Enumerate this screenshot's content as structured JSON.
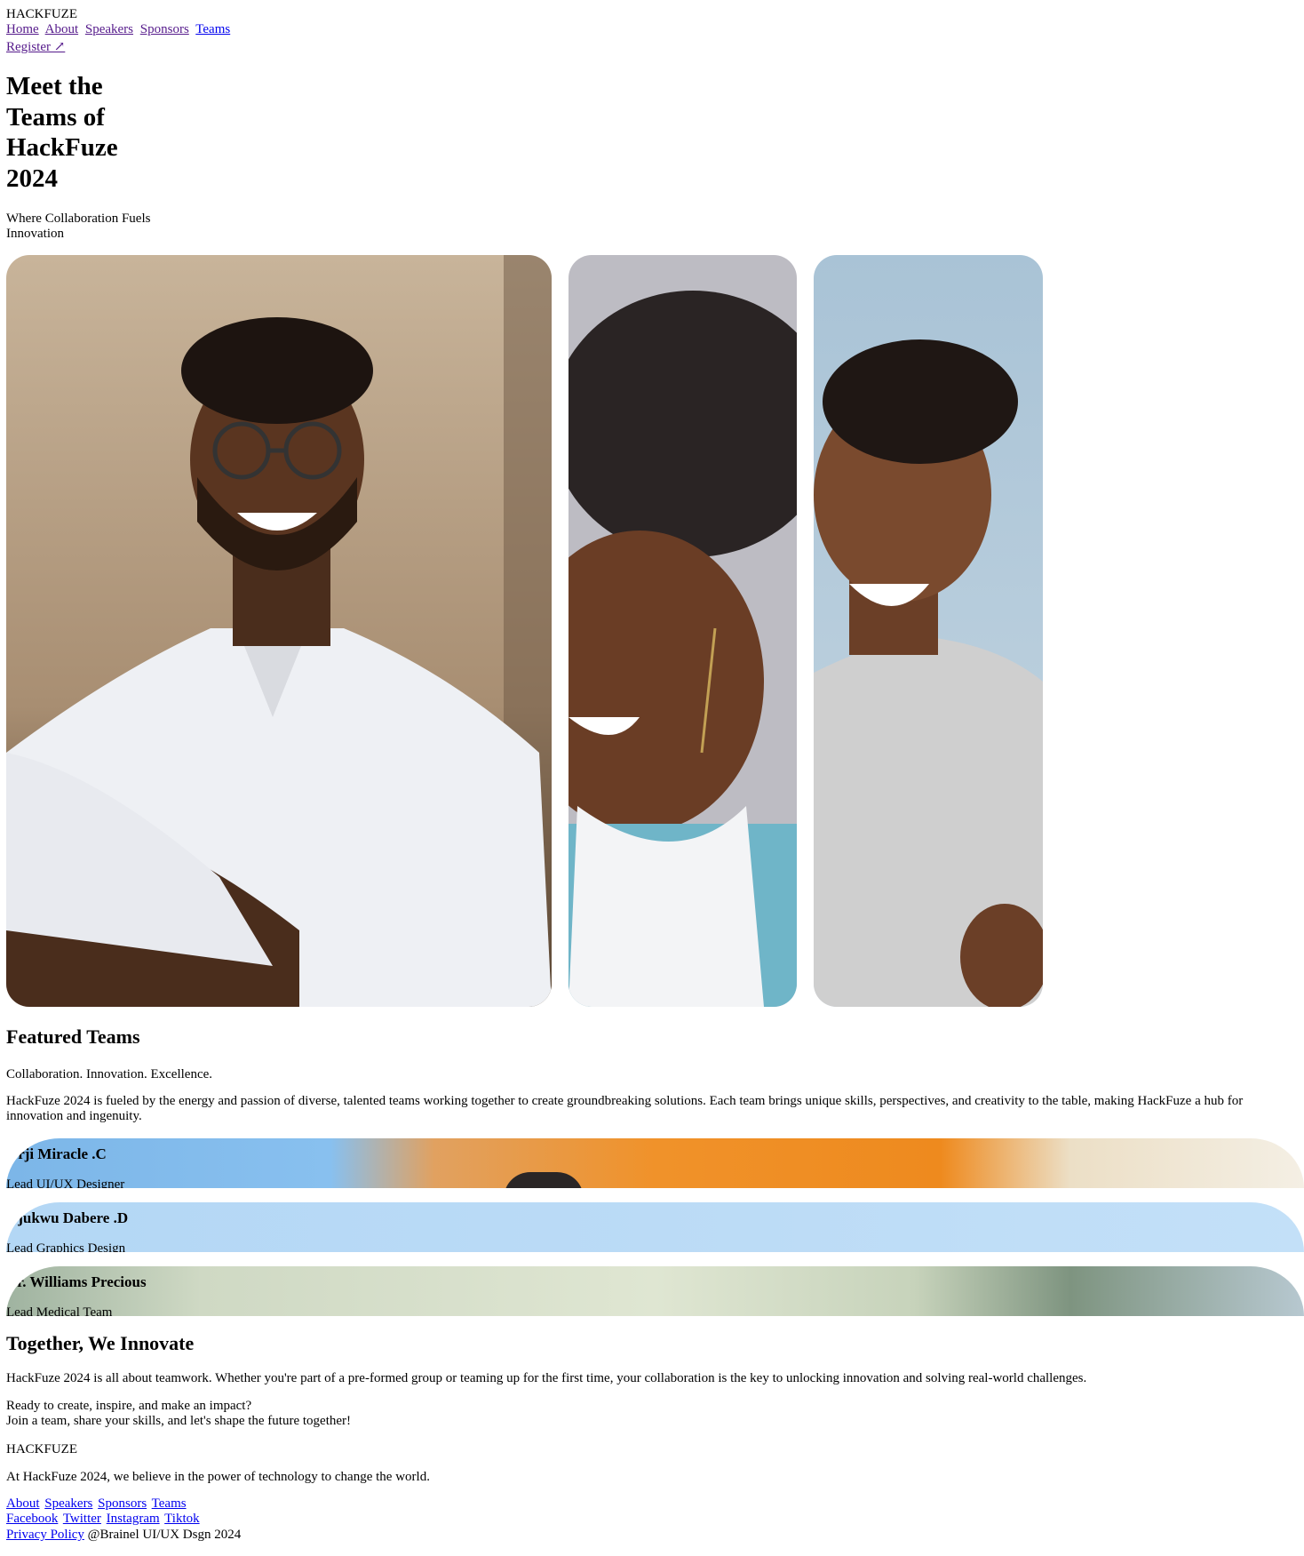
{
  "header": {
    "brand": "HACKFUZE",
    "nav": [
      "Home",
      "About",
      "Speakers",
      "Sponsors",
      "Teams"
    ],
    "register": "Register ↗"
  },
  "hero": {
    "title": "Meet the Teams of HackFuze 2024",
    "subtitle": "Where Collaboration Fuels Innovation"
  },
  "featured": {
    "title": "Featured Teams",
    "tagline": "Collaboration. Innovation. Excellence.",
    "description": "HackFuze 2024 is fueled by the energy and passion of diverse, talented teams working together to create groundbreaking solutions. Each team brings unique skills, perspectives, and creativity to the table, making HackFuze a hub for innovation and ingenuity.",
    "members": [
      {
        "name": "Orji Miracle .C",
        "role": "Lead UI/UX Designer"
      },
      {
        "name": "Ojukwu Dabere .D",
        "role": "Lead Graphics Design"
      },
      {
        "name": "Dr. Williams Precious",
        "role": "Lead Medical Team"
      }
    ]
  },
  "together": {
    "title": "Together, We Innovate",
    "description": "HackFuze 2024 is all about teamwork. Whether you're part of a pre-formed group or teaming up for the first time, your collaboration is the key to unlocking innovation and solving real-world challenges.",
    "cta_line1": "Ready to create, inspire, and make an impact?",
    "cta_line2": "Join a team, share your skills, and let's shape the future together!"
  },
  "footer": {
    "brand": "HACKFUZE",
    "about": "At HackFuze 2024, we believe in the power of technology to change the world.",
    "links": [
      "About",
      "Speakers",
      "Sponsors",
      "Teams"
    ],
    "social": [
      "Facebook",
      "Twitter",
      "Instagram",
      "Tiktok"
    ],
    "privacy": "Privacy Policy",
    "credit": "@Brainel UI/UX Dsgn 2024"
  }
}
